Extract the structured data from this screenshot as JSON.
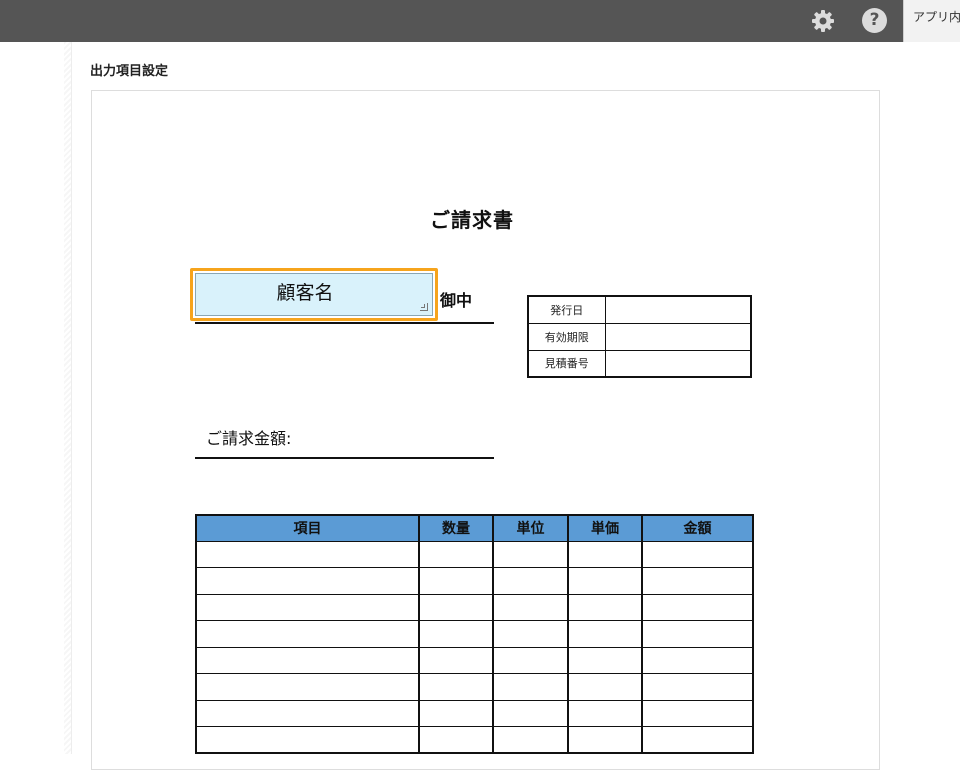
{
  "topbar": {
    "settings_icon": "gear-icon",
    "help_icon": "question-circle-icon",
    "help_glyph": "?",
    "app_tab_label": "アプリ内"
  },
  "section": {
    "title": "出力項目設定"
  },
  "document": {
    "title": "ご請求書",
    "customer_field_label": "顧客名",
    "honorific": "御中",
    "info_rows": [
      {
        "label": "発行日",
        "value": ""
      },
      {
        "label": "有効期限",
        "value": ""
      },
      {
        "label": "見積番号",
        "value": ""
      }
    ],
    "amount_label": "ご請求金額:",
    "items_table": {
      "headers": [
        "項目",
        "数量",
        "単位",
        "単価",
        "金額"
      ],
      "row_count": 8
    }
  },
  "colors": {
    "topbar": "#555555",
    "header_fill": "#5b9bd5",
    "field_fill": "#d9f2fb",
    "selection_outline": "#f6a41c"
  }
}
